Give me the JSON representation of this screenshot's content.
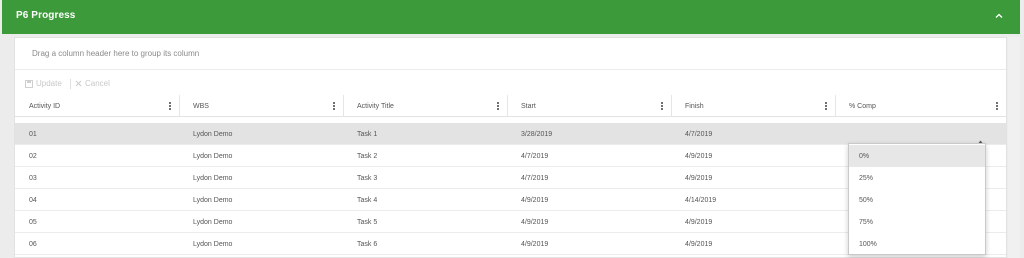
{
  "panel": {
    "title": "P6 Progress"
  },
  "grid": {
    "group_hint": "Drag a column header here to group its column",
    "toolbar": {
      "update_label": "Update",
      "cancel_label": "Cancel"
    },
    "columns": [
      {
        "label": "Activity ID"
      },
      {
        "label": "WBS"
      },
      {
        "label": "Activity Title"
      },
      {
        "label": "Start"
      },
      {
        "label": "Finish"
      },
      {
        "label": "% Comp"
      }
    ],
    "rows": [
      {
        "id": "01",
        "wbs": "Lydon Demo",
        "title": "Task 1",
        "start": "3/28/2019",
        "finish": "4/7/2019"
      },
      {
        "id": "02",
        "wbs": "Lydon Demo",
        "title": "Task 2",
        "start": "4/7/2019",
        "finish": "4/9/2019"
      },
      {
        "id": "03",
        "wbs": "Lydon Demo",
        "title": "Task 3",
        "start": "4/7/2019",
        "finish": "4/9/2019"
      },
      {
        "id": "04",
        "wbs": "Lydon Demo",
        "title": "Task 4",
        "start": "4/9/2019",
        "finish": "4/14/2019"
      },
      {
        "id": "05",
        "wbs": "Lydon Demo",
        "title": "Task 5",
        "start": "4/9/2019",
        "finish": "4/9/2019"
      },
      {
        "id": "06",
        "wbs": "Lydon Demo",
        "title": "Task 6",
        "start": "4/9/2019",
        "finish": "4/9/2019"
      }
    ],
    "dropdown_options": [
      "0%",
      "25%",
      "50%",
      "75%",
      "100%"
    ]
  },
  "colors": {
    "header_green": "#3d9a3b"
  },
  "icons": {
    "collapse": "chevron-up-icon",
    "update": "save-icon",
    "cancel": "close-icon",
    "column_menu": "vertical-ellipsis-icon",
    "dropdown": "caret-up-icon"
  }
}
